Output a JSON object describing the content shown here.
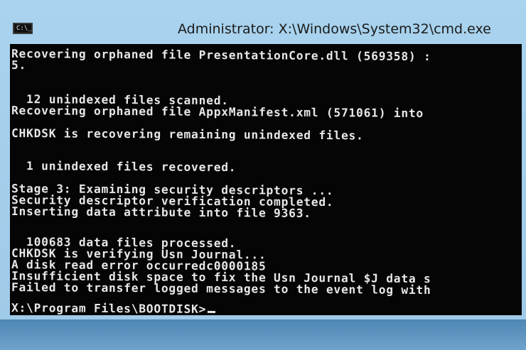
{
  "window": {
    "title": "Administrator: X:\\Windows\\System32\\cmd.exe",
    "icon_name": "console-icon",
    "icon_text": "C:\\_"
  },
  "console": {
    "lines": [
      "Recovering orphaned file PresentationCore.dll (569358) :",
      "5.",
      "",
      "  12 unindexed files scanned.",
      "Recovering orphaned file AppxManifest.xml (571061) into",
      "CHKDSK is recovering remaining unindexed files.",
      "",
      "  1 unindexed files recovered.",
      "",
      "Stage 3: Examining security descriptors ...",
      "Security descriptor verification completed.",
      "Inserting data attribute into file 9363.",
      "",
      "",
      "  100683 data files processed.",
      "CHKDSK is verifying Usn Journal...",
      "A disk read error occurredc0000185",
      "Insufficient disk space to fix the Usn Journal $J data s",
      "Failed to transfer logged messages to the event log with",
      "",
      "X:\\Program Files\\BOOTDISK>"
    ]
  },
  "colors": {
    "console_bg": "#050505",
    "console_fg": "#e8e8e8",
    "titlebar": "#a9d3ee"
  }
}
